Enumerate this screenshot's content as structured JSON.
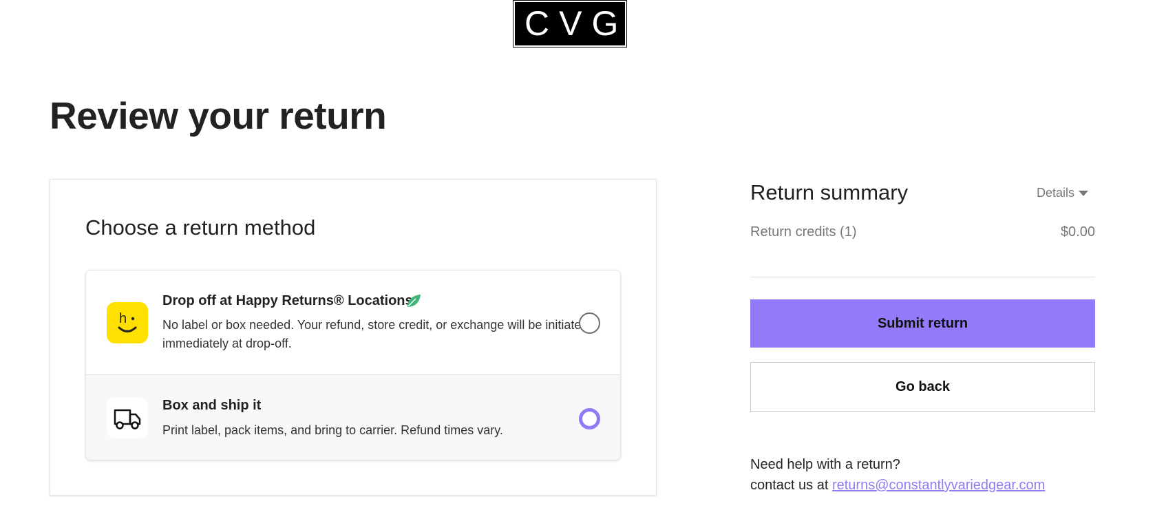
{
  "brand": {
    "logo_text": "CVG"
  },
  "page": {
    "title": "Review your return"
  },
  "return_method": {
    "title": "Choose a return method",
    "options": [
      {
        "label": "Drop off at Happy Returns® Locations",
        "description": "No label or box needed. Your refund, store credit, or exchange will be initiated immediately at drop-off.",
        "icon": "happy-returns-logo-icon",
        "badge_icon": "leaf-icon",
        "selected": false
      },
      {
        "label": "Box and ship it",
        "description": "Print label, pack items, and bring to carrier. Refund times vary.",
        "icon": "truck-icon",
        "selected": true
      }
    ]
  },
  "summary": {
    "title": "Return summary",
    "details_label": "Details",
    "credits_label": "Return credits (1)",
    "credits_value": "$0.00",
    "submit_label": "Submit return",
    "back_label": "Go back"
  },
  "help": {
    "line1": "Need help with a return?",
    "line2_prefix": "contact us at",
    "email": "returns@constantlyvariedgear.com"
  },
  "colors": {
    "accent": "#927afa",
    "radio_selected": "#8f7bf5",
    "happy_returns_yellow": "#ffe000",
    "leaf_green": "#3fb57a"
  }
}
